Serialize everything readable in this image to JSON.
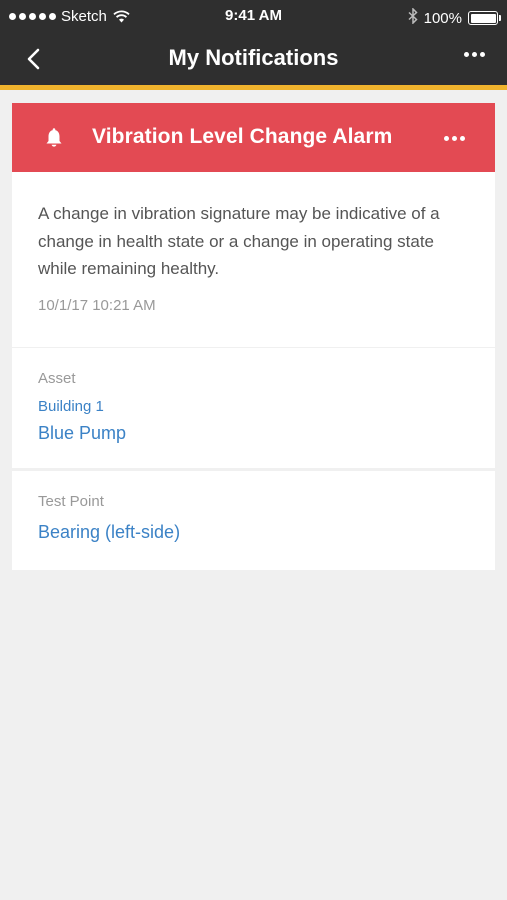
{
  "status_bar": {
    "carrier": "Sketch",
    "time": "9:41 AM",
    "battery": "100%"
  },
  "nav": {
    "title": "My Notifications",
    "back_icon": "chevron-left-icon",
    "more_icon": "more-horizontal-icon"
  },
  "alarm": {
    "icon": "bell-icon",
    "title": "Vibration Level Change Alarm",
    "description": "A change in vibration signature may be indicative of a change in health state or a change in operating state while remaining healthy.",
    "timestamp": "10/1/17 10:21 AM",
    "color": "#e34a53"
  },
  "asset": {
    "label": "Asset",
    "parent": "Building 1",
    "name": "Blue Pump"
  },
  "test_point": {
    "label": "Test Point",
    "name": "Bearing (left-side)"
  },
  "colors": {
    "nav_bg": "#2f2f2f",
    "nav_accent": "#f0b32d",
    "link": "#3b82c6",
    "page_bg": "#f0f0f0"
  }
}
